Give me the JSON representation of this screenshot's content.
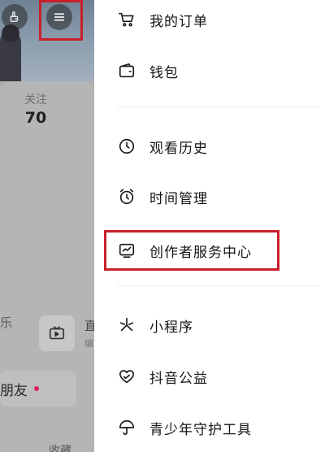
{
  "profile": {
    "following_label": "关注",
    "following_count": "70",
    "row_label_cut": "乐",
    "live_label_cut": "直",
    "live_sub_cut": "编",
    "friends_label": "朋友",
    "favorites_cut": "收藏"
  },
  "drawer": {
    "items": [
      {
        "label": "我的订单",
        "icon": "cart-icon"
      },
      {
        "label": "钱包",
        "icon": "wallet-icon"
      },
      {
        "label": "观看历史",
        "icon": "clock-icon"
      },
      {
        "label": "时间管理",
        "icon": "alarm-icon"
      },
      {
        "label": "创作者服务中心",
        "icon": "creator-chart-icon"
      },
      {
        "label": "小程序",
        "icon": "mini-program-icon"
      },
      {
        "label": "抖音公益",
        "icon": "charity-heart-icon"
      },
      {
        "label": "青少年守护工具",
        "icon": "umbrella-icon"
      }
    ]
  },
  "colors": {
    "highlight": "#c8202a",
    "notification_dot": "#e0245e"
  }
}
